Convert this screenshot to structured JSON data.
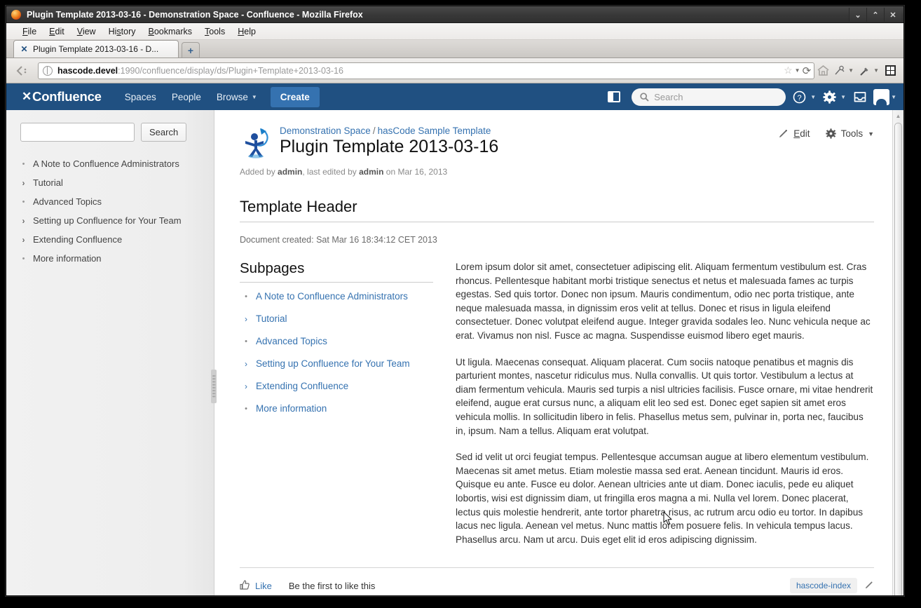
{
  "window": {
    "title": "Plugin Template 2013-03-16 - Demonstration Space - Confluence - Mozilla Firefox",
    "firefox_icon": "firefox-icon",
    "minimize": "⌄",
    "maximize": "⌃",
    "close": "✕"
  },
  "menubar": {
    "items": [
      "File",
      "Edit",
      "View",
      "History",
      "Bookmarks",
      "Tools",
      "Help"
    ]
  },
  "tabs": {
    "active": {
      "favicon": "confluence-favicon",
      "label": "Plugin Template 2013-03-16 - D..."
    },
    "new_tab_label": "+"
  },
  "urlbar": {
    "back_forward": "‹",
    "host": "hascode.devel",
    "rest": ":1990/confluence/display/ds/Plugin+Template+2013-03-16",
    "bookmark_star": "☆",
    "reload": "⟳",
    "home": "home-icon",
    "addon1": "addon-icon",
    "addon2": "eyedropper-icon",
    "addon3": "grid-icon"
  },
  "confluence_header": {
    "logo_glyph": "✕",
    "logo_text": "Confluence",
    "nav": [
      {
        "label": "Spaces",
        "caret": false
      },
      {
        "label": "People",
        "caret": false
      },
      {
        "label": "Browse",
        "caret": true
      }
    ],
    "create_label": "Create",
    "search_placeholder": "Search",
    "search_value": "",
    "help_icon": "?",
    "gear_icon": "⚙",
    "inbox_icon": "inbox-icon",
    "avatar_icon": "user-avatar-icon",
    "brand_color": "#205081",
    "create_color": "#3572b0"
  },
  "sidebar": {
    "search_value": "",
    "search_button": "Search",
    "items": [
      {
        "marker": "•",
        "label": "A Note to Confluence Administrators"
      },
      {
        "marker": "›",
        "label": "Tutorial"
      },
      {
        "marker": "•",
        "label": "Advanced Topics"
      },
      {
        "marker": "›",
        "label": "Setting up Confluence for Your Team"
      },
      {
        "marker": "›",
        "label": "Extending Confluence"
      },
      {
        "marker": "•",
        "label": "More information"
      }
    ]
  },
  "page": {
    "logo": "hascode-logo",
    "breadcrumb": {
      "space": "Demonstration Space",
      "separator": "/",
      "parent": "hasCode Sample Template"
    },
    "title": "Plugin Template 2013-03-16",
    "byline": {
      "added_by_prefix": "Added by ",
      "author": "admin",
      "middle": ", last edited by ",
      "editor": "admin",
      "suffix": " on Mar 16, 2013"
    },
    "actions": [
      {
        "icon": "pencil-icon",
        "label": "Edit",
        "caret": false
      },
      {
        "icon": "gear-icon",
        "label": "Tools",
        "caret": true
      }
    ],
    "section_header": "Template Header",
    "document_created": "Document created: Sat Mar 16 18:34:12 CET 2013",
    "subpages_heading": "Subpages",
    "subpages": [
      {
        "marker": "•",
        "label": "A Note to Confluence Administrators"
      },
      {
        "marker": "›",
        "label": "Tutorial"
      },
      {
        "marker": "•",
        "label": "Advanced Topics"
      },
      {
        "marker": "›",
        "label": "Setting up Confluence for Your Team"
      },
      {
        "marker": "›",
        "label": "Extending Confluence"
      },
      {
        "marker": "•",
        "label": "More information"
      }
    ],
    "paragraphs": [
      "Lorem ipsum dolor sit amet, consectetuer adipiscing elit. Aliquam fermentum vestibulum est. Cras rhoncus. Pellentesque habitant morbi tristique senectus et netus et malesuada fames ac turpis egestas. Sed quis tortor. Donec non ipsum. Mauris condimentum, odio nec porta tristique, ante neque malesuada massa, in dignissim eros velit at tellus. Donec et risus in ligula eleifend consectetuer. Donec volutpat eleifend augue. Integer gravida sodales leo. Nunc vehicula neque ac erat. Vivamus non nisl. Fusce ac magna. Suspendisse euismod libero eget mauris.",
      "Ut ligula. Maecenas consequat. Aliquam placerat. Cum sociis natoque penatibus et magnis dis parturient montes, nascetur ridiculus mus. Nulla convallis. Ut quis tortor. Vestibulum a lectus at diam fermentum vehicula. Mauris sed turpis a nisl ultricies facilisis. Fusce ornare, mi vitae hendrerit eleifend, augue erat cursus nunc, a aliquam elit leo sed est. Donec eget sapien sit amet eros vehicula mollis. In sollicitudin libero in felis. Phasellus metus sem, pulvinar in, porta nec, faucibus in, ipsum. Nam a tellus. Aliquam erat volutpat.",
      "Sed id velit ut orci feugiat tempus. Pellentesque accumsan augue at libero elementum vestibulum. Maecenas sit amet metus. Etiam molestie massa sed erat. Aenean tincidunt. Mauris id eros. Quisque eu ante. Fusce eu dolor. Aenean ultricies ante ut diam. Donec iaculis, pede eu aliquet lobortis, wisi est dignissim diam, ut fringilla eros magna a mi. Nulla vel lorem. Donec placerat, lectus quis molestie hendrerit, ante tortor pharetra risus, ac rutrum arcu odio eu tortor. In dapibus lacus nec ligula. Aenean vel metus. Nunc mattis lorem posuere felis. In vehicula tempus lacus. Phasellus arcu. Nam ut arcu. Duis eget elit id eros adipiscing dignissim."
    ],
    "footer": {
      "like_icon": "thumbs-up-icon",
      "like_label": "Like",
      "like_status": "Be the first to like this",
      "labels": [
        "hascode-index"
      ],
      "label_edit_icon": "pencil-icon"
    }
  }
}
